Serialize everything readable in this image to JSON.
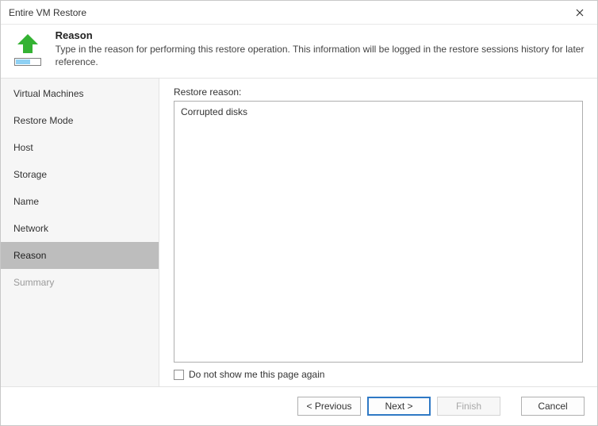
{
  "window": {
    "title": "Entire VM Restore"
  },
  "header": {
    "heading": "Reason",
    "description": "Type in the reason for performing this restore operation. This information will be logged in the restore sessions history for later reference."
  },
  "sidebar": {
    "items": [
      {
        "label": "Virtual Machines"
      },
      {
        "label": "Restore Mode"
      },
      {
        "label": "Host"
      },
      {
        "label": "Storage"
      },
      {
        "label": "Name"
      },
      {
        "label": "Network"
      },
      {
        "label": "Reason"
      },
      {
        "label": "Summary"
      }
    ],
    "active_index": 6,
    "dim_index": 7
  },
  "main": {
    "field_label": "Restore reason:",
    "reason_value": "Corrupted disks",
    "dont_show_label": "Do not show me this page again",
    "dont_show_checked": false
  },
  "footer": {
    "previous": "< Previous",
    "next": "Next >",
    "finish": "Finish",
    "cancel": "Cancel"
  },
  "icons": {
    "arrow_color": "#34b233",
    "progress_frame": "#7f7f7f",
    "progress_fill": "#8fd1f4"
  }
}
